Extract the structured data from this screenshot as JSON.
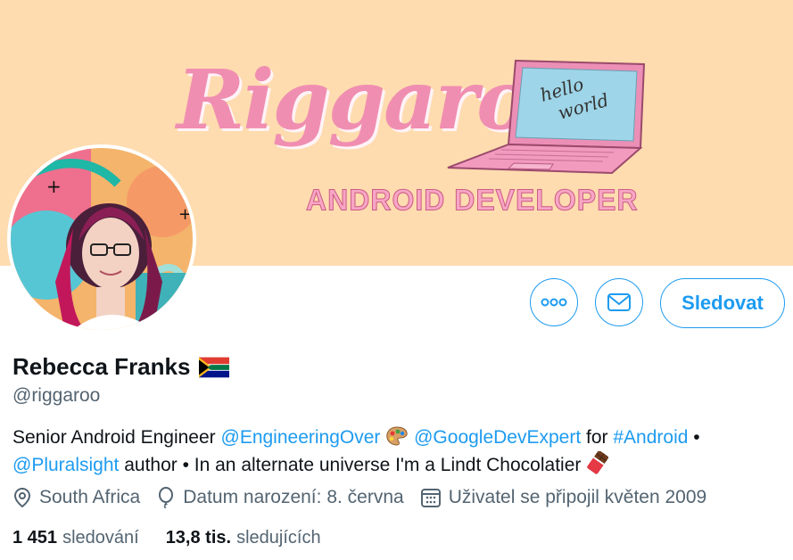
{
  "banner": {
    "title": "Riggaroo",
    "subtitle": "ANDROID DEVELOPER",
    "laptop_text": [
      "hello",
      "world"
    ],
    "background": "#fedcaf"
  },
  "actions": {
    "more_icon": "more-horizontal-icon",
    "message_icon": "envelope-icon",
    "follow_label": "Sledovat"
  },
  "profile": {
    "name": "Rebecca Franks",
    "handle": "@riggaroo",
    "flag_icon": "south-africa-flag-icon"
  },
  "bio": {
    "text1": "Senior Android Engineer ",
    "link1": "@EngineeringOver",
    "link2": "@GoogleDevExpert",
    "text2": " for ",
    "link3": "#Android",
    "text3": " •",
    "link4": "@Pluralsight",
    "text4": " author • In an alternate universe I'm a Lindt Chocolatier "
  },
  "meta": {
    "location": "South Africa",
    "birthday": "Datum narození: 8. června",
    "joined": "Uživatel se připojil květen 2009"
  },
  "stats": {
    "following_count": "1 451",
    "following_label": "sledování",
    "followers_count": "13,8 tis.",
    "followers_label": "sledujících"
  },
  "colors": {
    "accent": "#1d9bf0",
    "secondary_text": "#536471",
    "primary_text": "#0f1419",
    "banner_pink": "#f08eb1"
  }
}
